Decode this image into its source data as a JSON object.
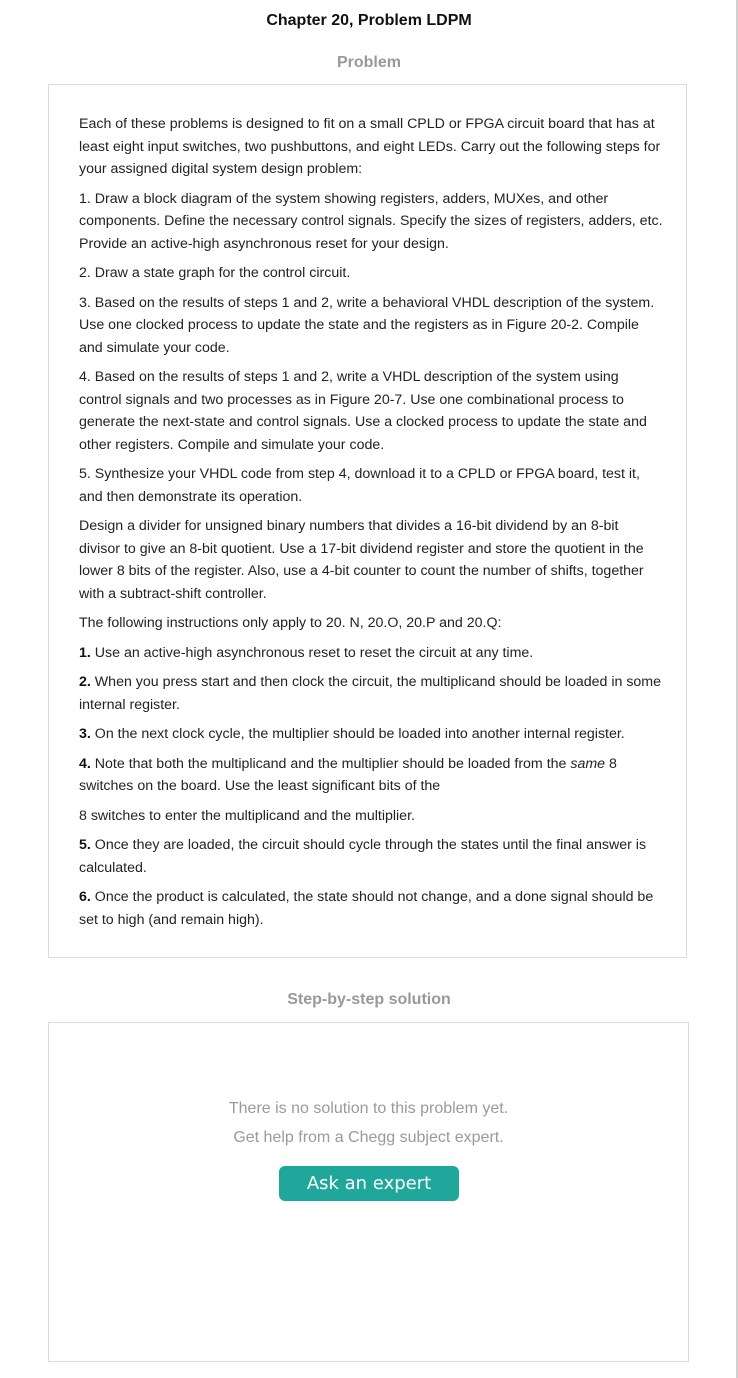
{
  "header": {
    "chapter_title": "Chapter 20, Problem LDPM"
  },
  "problem": {
    "section_title": "Problem",
    "intro": "Each of these problems is designed to fit on a small CPLD or FPGA circuit board that has at least eight input switches, two pushbuttons, and eight LEDs. Carry out the following steps for your assigned digital system design problem:",
    "steps": [
      "1. Draw a block diagram of the system showing registers, adders, MUXes, and other components. Define the necessary control signals. Specify the sizes of registers, adders, etc. Provide an active-high asynchronous reset for your design.",
      "2. Draw a state graph for the control circuit.",
      "3. Based on the results of steps 1 and 2, write a behavioral VHDL description of the system. Use one clocked process to update the state and the registers as in Figure 20-2. Compile and simulate your code.",
      "4. Based on the results of steps 1 and 2, write a VHDL description of the system using control signals and two processes as in Figure 20-7. Use one combinational process to generate the next-state and control signals. Use a clocked process to update the state and other registers. Compile and simulate your code.",
      "5. Synthesize your VHDL code from step 4, download it to a CPLD or FPGA board, test it, and then demonstrate its operation."
    ],
    "design": "Design a divider for unsigned binary numbers that divides a 16-bit dividend by an 8-bit divisor to give an 8-bit quotient. Use a 17-bit dividend register and store the quotient in the lower 8 bits of the register. Also, use a 4-bit counter to count the number of shifts, together with a subtract-shift controller.",
    "instructions_intro": "The following instructions only apply to 20. N, 20.O, 20.P and 20.Q:",
    "instructions": [
      {
        "num": "1.",
        "text": " Use an active-high asynchronous reset to reset the circuit at any time."
      },
      {
        "num": "2.",
        "text": " When you press start and then clock the circuit, the multiplicand should be loaded in some internal register."
      },
      {
        "num": "3.",
        "text": " On the next clock cycle, the multiplier should be loaded into another internal register."
      },
      {
        "num": "4.",
        "text": " Note that both the multiplicand and the multiplier should be loaded from the ",
        "emph": "same",
        "text_after": " 8 switches on the board. Use the least significant bits of the"
      },
      {
        "num": "",
        "text": "8 switches to enter the multiplicand and the multiplier."
      },
      {
        "num": "5.",
        "text": " Once they are loaded, the circuit should cycle through the states until the final answer is calculated."
      },
      {
        "num": "6.",
        "text": " Once the product is calculated, the state should not change, and a done signal should be set to high (and remain high)."
      }
    ]
  },
  "solution": {
    "section_title": "Step-by-step solution",
    "line1": "There is no solution to this problem yet.",
    "line2": "Get help from a Chegg subject expert.",
    "ask_button": "Ask an expert"
  }
}
